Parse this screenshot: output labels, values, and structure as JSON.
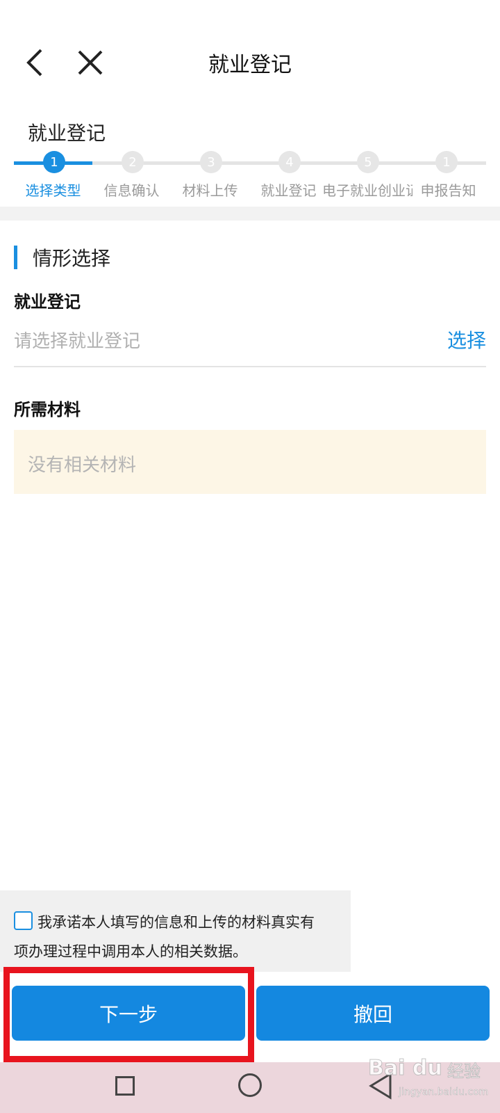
{
  "header": {
    "title": "就业登记"
  },
  "steps": {
    "title": "就业登记",
    "items": [
      {
        "number": "1",
        "label": "选择类型"
      },
      {
        "number": "2",
        "label": "信息确认"
      },
      {
        "number": "3",
        "label": "材料上传"
      },
      {
        "number": "4",
        "label": "就业登记"
      },
      {
        "number": "5",
        "label": "电子就业创业证预览"
      },
      {
        "number": "1",
        "label": "申报告知"
      }
    ],
    "active_index": 0
  },
  "section": {
    "title": "情形选择"
  },
  "employment_field": {
    "label": "就业登记",
    "placeholder": "请选择就业登记",
    "action": "选择"
  },
  "materials": {
    "label": "所需材料",
    "empty_text": "没有相关材料"
  },
  "consent": {
    "line1": "我承诺本人填写的信息和上传的材料真实有",
    "line2": "项办理过程中调用本人的相关数据。",
    "checked": false
  },
  "buttons": {
    "next": "下一步",
    "revoke": "撤回"
  },
  "watermark": {
    "logo": "Bai du",
    "cn": "经验",
    "url": "jingyan.baidu.com"
  },
  "colors": {
    "accent": "#1a8fe0",
    "highlight": "#e8141e",
    "materials_bg": "#fdf6e6"
  }
}
